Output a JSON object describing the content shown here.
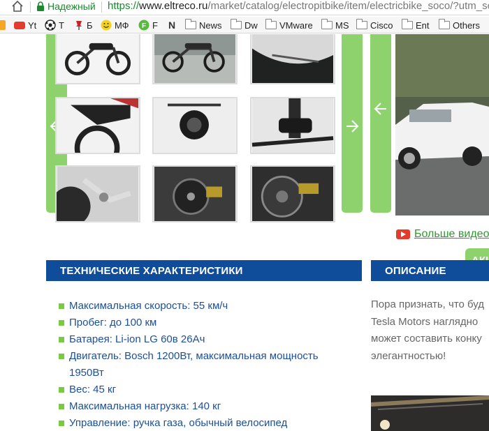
{
  "browser": {
    "secure_label": "Надежный",
    "url_scheme": "https://",
    "url_host": "www.eltreco.ru",
    "url_path": "/market/catalog/electropitbike/item/electricbike_soco/?utm_so"
  },
  "bookmarks": [
    {
      "label": "",
      "icon": "orange-badge-icon",
      "color": "#f5a623"
    },
    {
      "label": "Yt",
      "icon": "youtube-icon",
      "color": "#e53b2c"
    },
    {
      "label": "T",
      "icon": "soccer-ball-icon",
      "color": "#222"
    },
    {
      "label": "Б",
      "icon": "red-pin-icon",
      "color": "#c6242b"
    },
    {
      "label": "МФ",
      "icon": "smiley-icon",
      "color": "#f4d31c"
    },
    {
      "label": "F",
      "icon": "green-f-icon",
      "color": "#5ab840"
    },
    {
      "label": "",
      "icon": "n-icon",
      "color": "#333"
    },
    {
      "label": "News",
      "icon": "folder-icon"
    },
    {
      "label": "Dw",
      "icon": "folder-icon"
    },
    {
      "label": "VMware",
      "icon": "folder-icon"
    },
    {
      "label": "MS",
      "icon": "folder-icon"
    },
    {
      "label": "Cisco",
      "icon": "folder-icon"
    },
    {
      "label": "Ent",
      "icon": "folder-icon"
    },
    {
      "label": "Others",
      "icon": "folder-icon"
    }
  ],
  "video": {
    "link_label": "Больше видео",
    "button_label": "АКЦ"
  },
  "specs": {
    "heading": "ТЕХНИЧЕСКИЕ ХАРАКТЕРИСТИКИ",
    "items": [
      "Максимальная скорость: 55 км/ч",
      "Пробег: до 100 км",
      "Батарея: Li-ion LG 60в 26Ач",
      "Двигатель: Bosch 1200Вт, максимальная мощность 1950Вт",
      "Вес: 45 кг",
      "Максимальная нагрузка: 140 кг",
      "Управление: ручка газа, обычный велосипед"
    ]
  },
  "description": {
    "heading": "ОПИСАНИЕ",
    "lines": [
      "Пора признать, что буд",
      "Tesla Motors наглядно",
      "может составить конку",
      "элегантностью!"
    ]
  },
  "colors": {
    "accent_green": "#8ed26e",
    "heading_blue": "#0f4c9a",
    "link_blue": "#1a4f9c",
    "bullet_green": "#7ac943"
  }
}
